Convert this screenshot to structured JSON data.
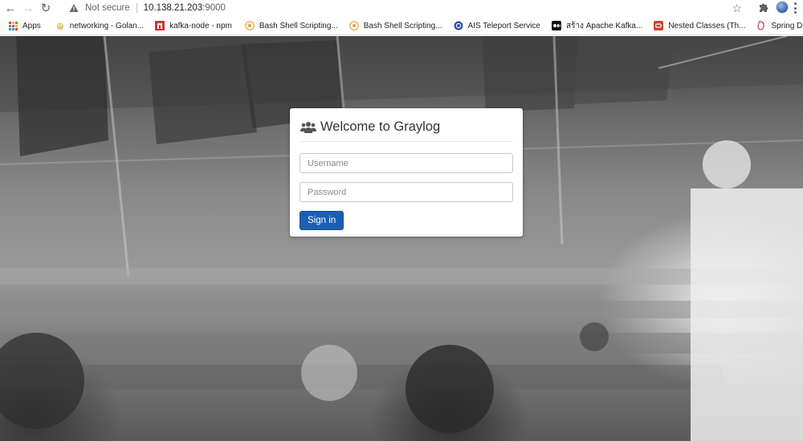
{
  "browser": {
    "security_label": "Not secure",
    "url_host": "10.138.21.203",
    "url_port": ":9000"
  },
  "bookmarks": [
    {
      "label": "Apps",
      "icon": "apps-grid-icon"
    },
    {
      "label": "networking - Golan...",
      "icon": "gopher-favicon-icon"
    },
    {
      "label": "kafka-node - npm",
      "icon": "npm-favicon-icon"
    },
    {
      "label": "Bash Shell Scripting...",
      "icon": "site-favicon-icon"
    },
    {
      "label": "Bash Shell Scripting...",
      "icon": "site-favicon-icon"
    },
    {
      "label": "AIS Teleport Service",
      "icon": "teleport-favicon-icon"
    },
    {
      "label": "สร้าง Apache Kafka...",
      "icon": "medium-favicon-icon"
    },
    {
      "label": "Nested Classes (Th...",
      "icon": "oracle-favicon-icon"
    },
    {
      "label": "Spring Data Mongo...",
      "icon": "spring-favicon-icon"
    }
  ],
  "login": {
    "title": "Welcome to Graylog",
    "username_placeholder": "Username",
    "password_placeholder": "Password",
    "signin_label": "Sign in"
  },
  "colors": {
    "primary_button": "#1a5fb4",
    "warning_icon": "#5f6368"
  }
}
